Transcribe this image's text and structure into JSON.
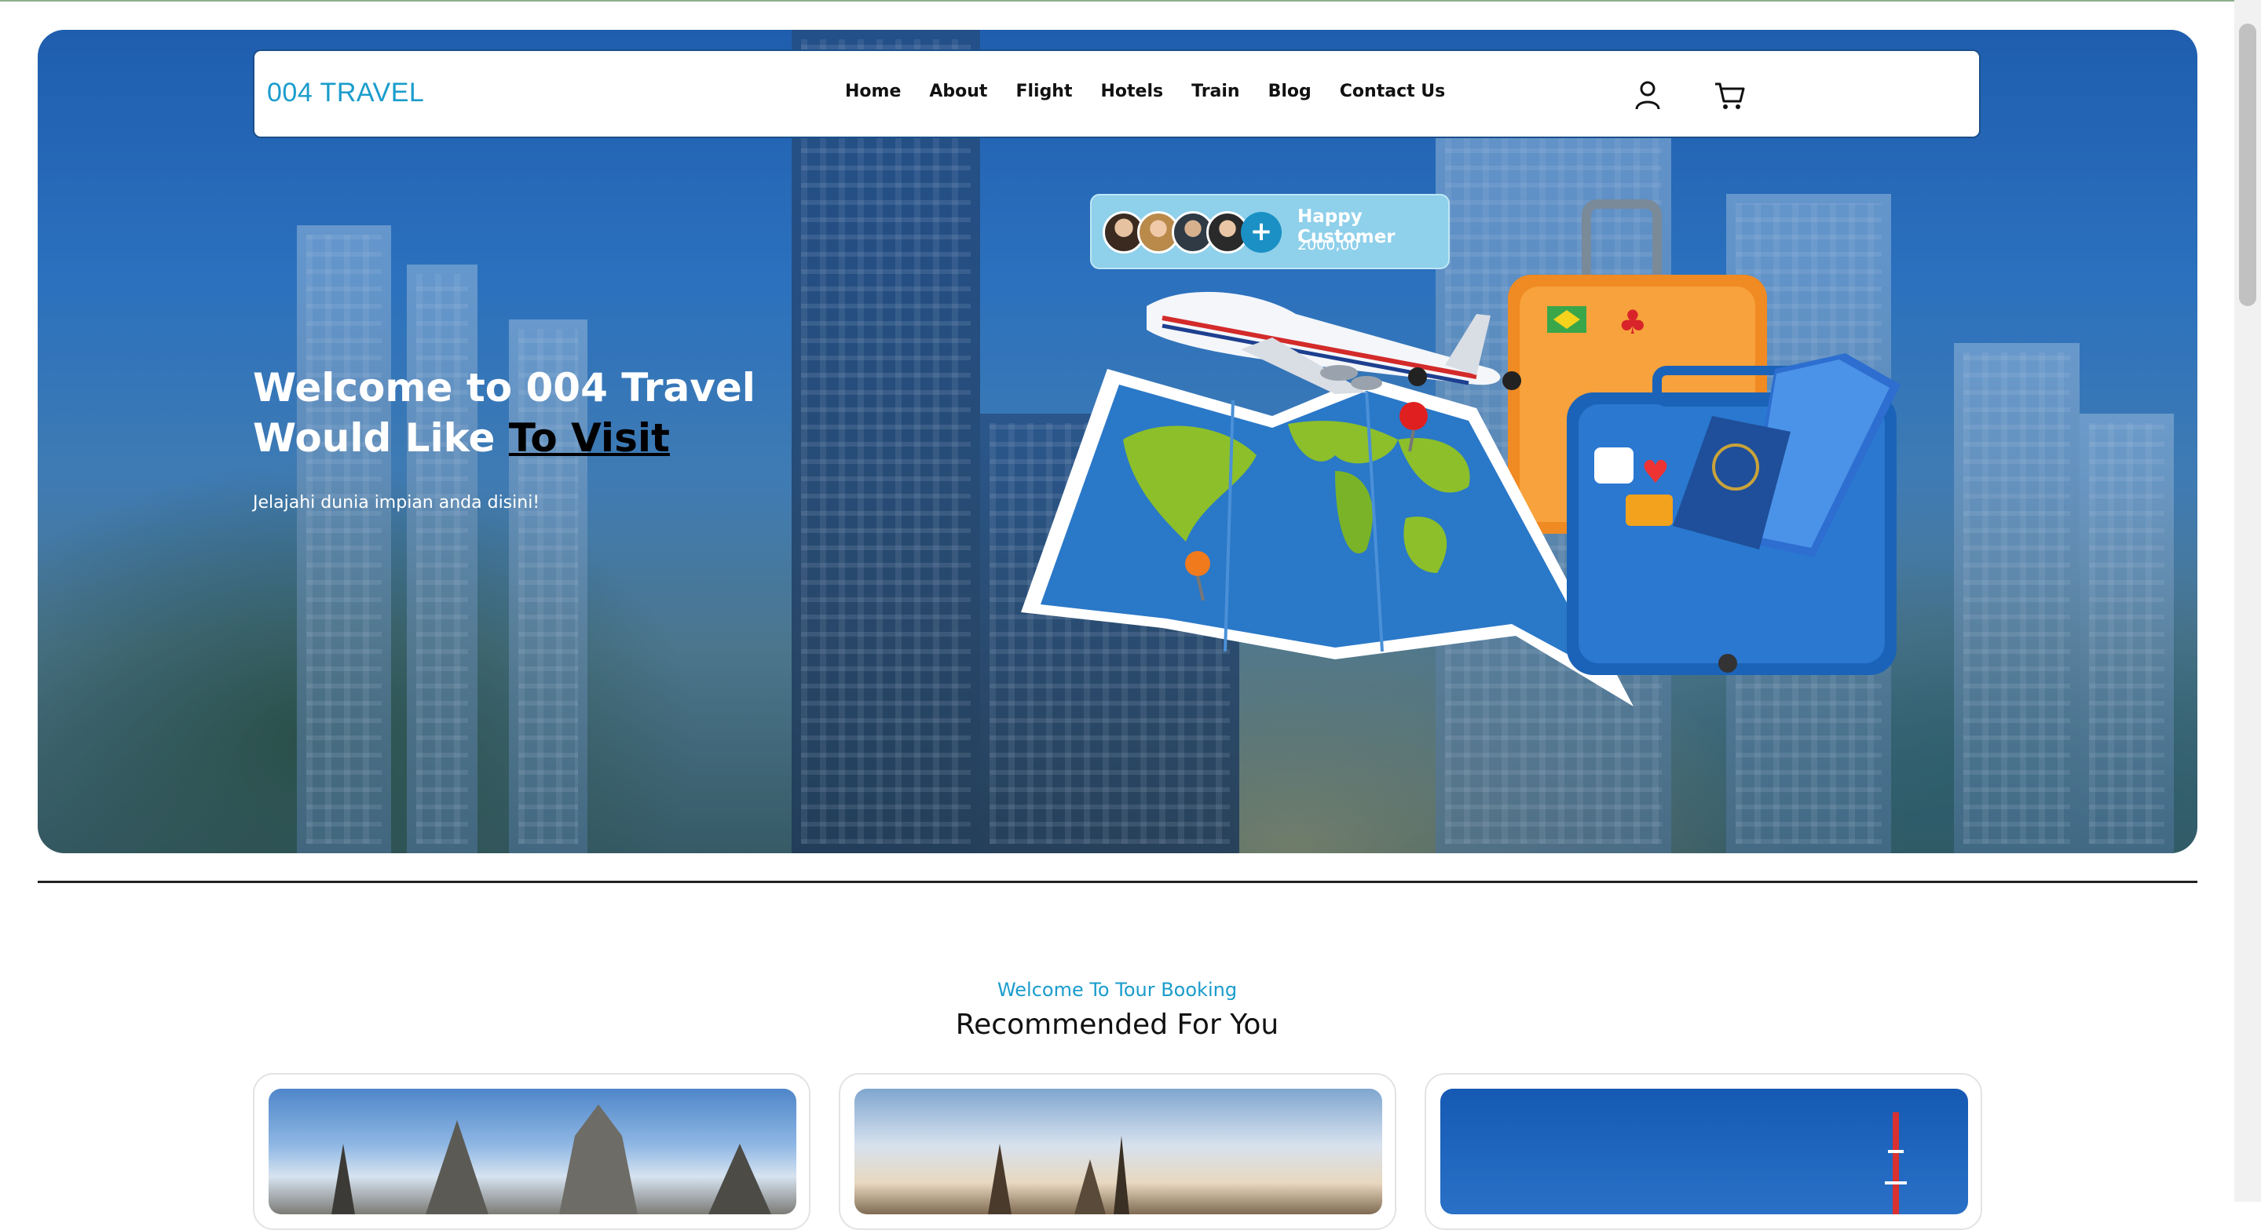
{
  "brand": "004 TRAVEL",
  "nav": {
    "items": [
      "Home",
      "About",
      "Flight",
      "Hotels",
      "Train",
      "Blog",
      "Contact Us"
    ]
  },
  "icons": {
    "account": "user-icon",
    "cart": "cart-icon"
  },
  "hero": {
    "title_line1": "Welcome to 004 Travel",
    "title_line2_prefix": "Would Like ",
    "title_line2_highlight": "To Visit",
    "subtitle": "Jelajahi dunia impian anda disini!"
  },
  "happy_customer": {
    "label": "Happy Customer",
    "count": "2000,00",
    "plus": "+"
  },
  "section": {
    "kicker": "Welcome To Tour Booking",
    "title": "Recommended For You"
  },
  "colors": {
    "accent": "#1a9ccc",
    "nav_border": "#1b4f8a",
    "happy_bg": "#8fd0ea"
  }
}
